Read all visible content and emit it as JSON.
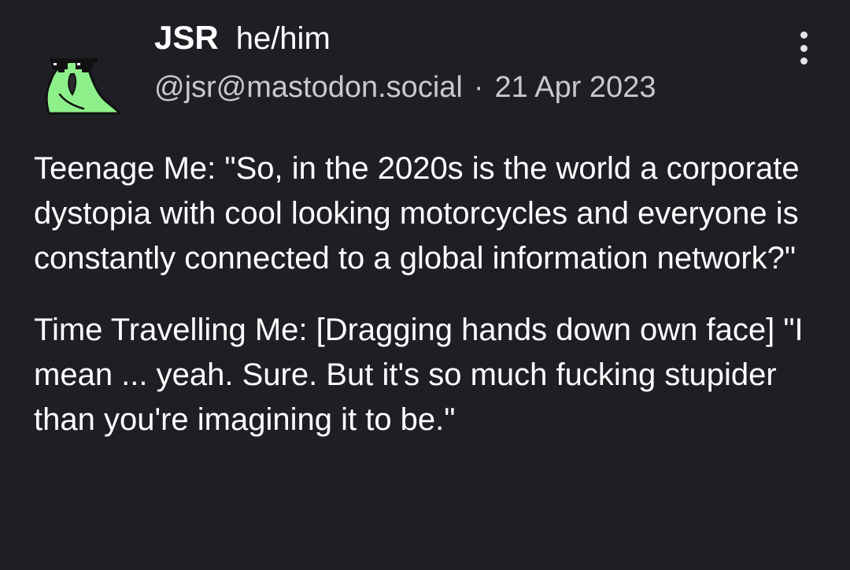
{
  "post": {
    "author": {
      "display_name": "JSR",
      "pronouns": "he/him",
      "handle": "@jsr@mastodon.social",
      "avatar_icon": "parrot-with-sunglasses-icon"
    },
    "separator": "·",
    "date": "21 Apr 2023",
    "more_icon": "more-vertical-icon",
    "paragraphs": [
      "Teenage Me: \"So, in the 2020s is the world a corporate dystopia with cool looking motorcycles and everyone is constantly connected to a global information network?\"",
      "Time Travelling Me: [Dragging hands down own face] \"I mean ... yeah. Sure. But it's so much fucking stupider than you're imagining it to be.\""
    ]
  },
  "colors": {
    "background": "#1f1e24",
    "text": "#ffffff",
    "meta_text": "#c9c8d0",
    "avatar_green": "#8ef08a"
  }
}
